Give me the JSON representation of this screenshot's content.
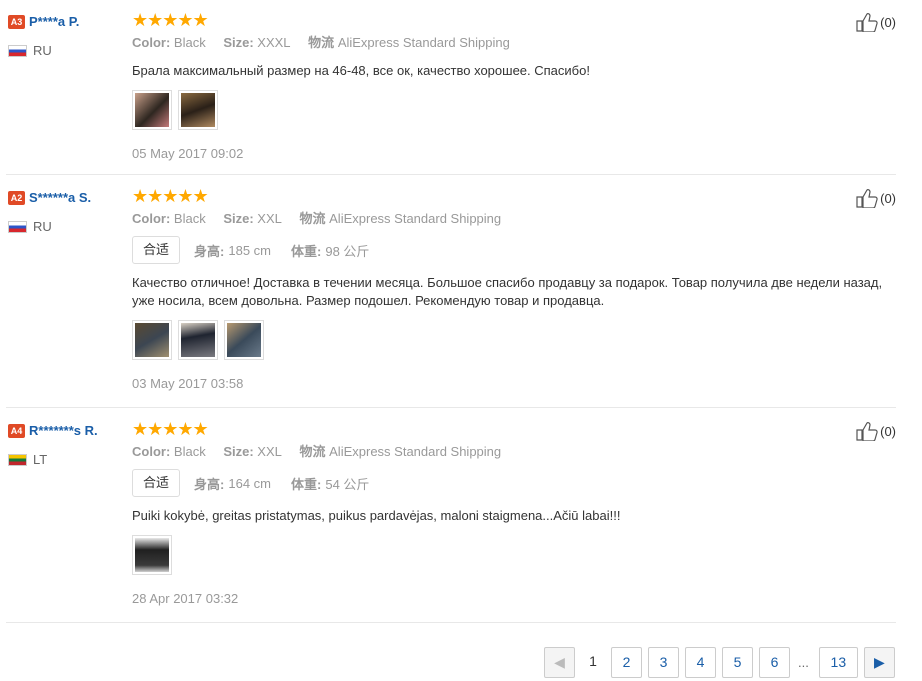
{
  "reviews": [
    {
      "level": "A3",
      "name": "P****a P.",
      "country": "RU",
      "rating": "★★★★★",
      "color_label": "Color:",
      "color": "Black",
      "size_label": "Size:",
      "size": "XXXL",
      "ship_label": "物流",
      "shipping": "AliExpress Standard Shipping",
      "text": "Брала максимальный размер на 46-48, все ок, качество хорошее. Спасибо!",
      "date": "05 May 2017 09:02",
      "likes": "(0)"
    },
    {
      "level": "A2",
      "name": "S******a S.",
      "country": "RU",
      "rating": "★★★★★",
      "color_label": "Color:",
      "color": "Black",
      "size_label": "Size:",
      "size": "XXL",
      "ship_label": "物流",
      "shipping": "AliExpress Standard Shipping",
      "fit": "合适",
      "height_label": "身高:",
      "height": "185 cm",
      "weight_label": "体重:",
      "weight": "98 公斤",
      "text": "Качество отличное! Доставка в течении месяца. Большое спасибо продавцу за подарок. Товар получила две недели назад, уже носила, всем довольна. Размер подошел. Рекомендую товар и продавца.",
      "date": "03 May 2017 03:58",
      "likes": "(0)"
    },
    {
      "level": "A4",
      "name": "R*******s R.",
      "country": "LT",
      "rating": "★★★★★",
      "color_label": "Color:",
      "color": "Black",
      "size_label": "Size:",
      "size": "XXL",
      "ship_label": "物流",
      "shipping": "AliExpress Standard Shipping",
      "fit": "合适",
      "height_label": "身高:",
      "height": "164 cm",
      "weight_label": "体重:",
      "weight": "54 公斤",
      "text": "Puiki kokybė, greitas pristatymas, puikus pardavėjas, maloni staigmena...Ačiū labai!!!",
      "date": "28 Apr 2017 03:32",
      "likes": "(0)"
    }
  ],
  "pagination": {
    "prev": "◀",
    "current": "1",
    "pages": [
      "2",
      "3",
      "4",
      "5",
      "6"
    ],
    "ellipsis": "...",
    "last": "13",
    "next": "▶"
  },
  "icons": {
    "like": "thumbs-up-icon",
    "flag_ru": "russia-flag-icon",
    "flag_lt": "lithuania-flag-icon"
  },
  "colors": {
    "accent": "#1a5ea8",
    "stars": "#ffa800",
    "level_badge": "#e04a26"
  }
}
